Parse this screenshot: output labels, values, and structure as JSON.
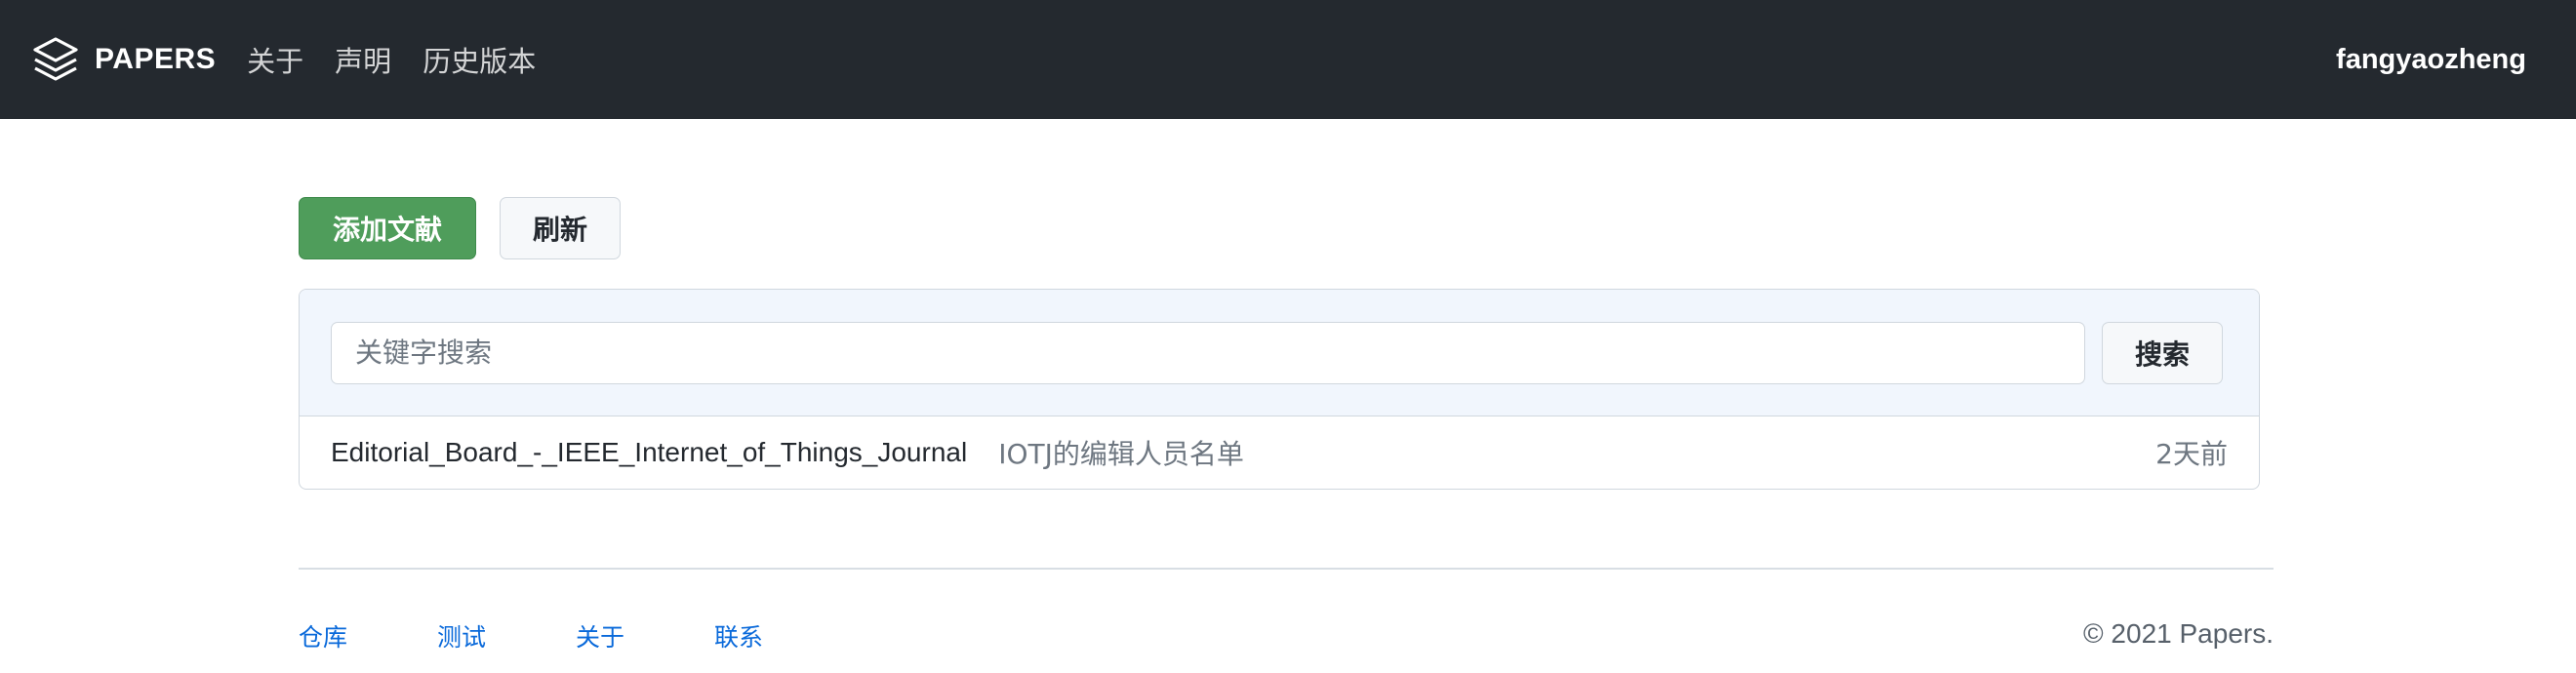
{
  "header": {
    "brand": "PAPERS",
    "logo_icon": "layers-icon",
    "nav": [
      {
        "label": "关于"
      },
      {
        "label": "声明"
      },
      {
        "label": "历史版本"
      }
    ],
    "user": "fangyaozheng"
  },
  "actions": {
    "add_label": "添加文献",
    "refresh_label": "刷新"
  },
  "search": {
    "placeholder": "关键字搜索",
    "value": "",
    "button_label": "搜索"
  },
  "papers": [
    {
      "title": "Editorial_Board_-_IEEE_Internet_of_Things_Journal",
      "description": "IOTJ的编辑人员名单",
      "time": "2天前"
    }
  ],
  "footer": {
    "links": [
      {
        "label": "仓库"
      },
      {
        "label": "测试"
      },
      {
        "label": "关于"
      },
      {
        "label": "联系"
      }
    ],
    "copyright": "© 2021 Papers."
  },
  "colors": {
    "header_bg": "#24292f",
    "primary_button": "#4f9d5b",
    "link": "#0969da"
  }
}
